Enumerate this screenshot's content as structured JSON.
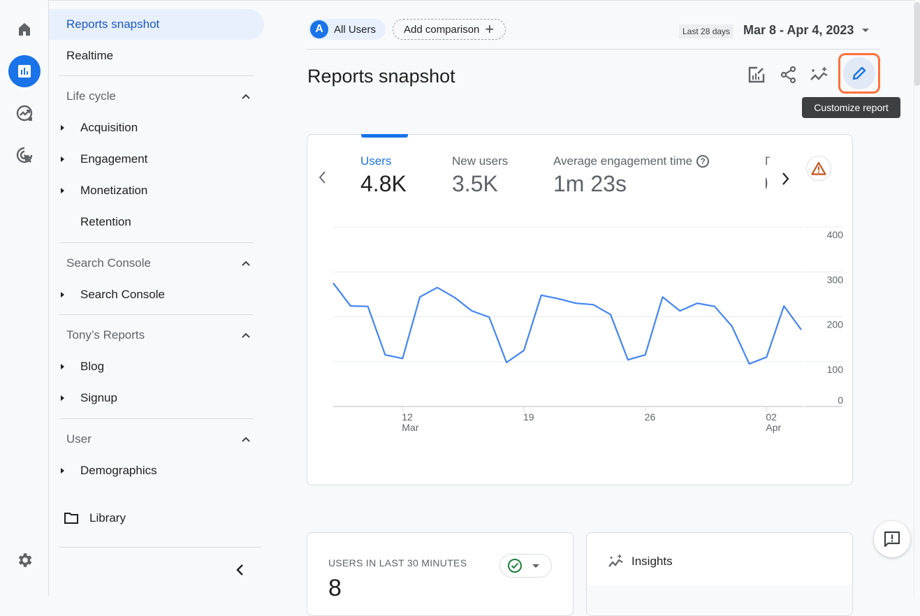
{
  "rail": {
    "items": [
      {
        "icon": "home-icon"
      },
      {
        "icon": "reports-icon",
        "active": true
      },
      {
        "icon": "explore-icon"
      },
      {
        "icon": "advertising-icon"
      }
    ],
    "settings_icon": "gear-icon"
  },
  "nav": {
    "top_items": [
      {
        "label": "Reports snapshot",
        "active": true
      },
      {
        "label": "Realtime"
      }
    ],
    "sections": [
      {
        "title": "Life cycle",
        "items": [
          "Acquisition",
          "Engagement",
          "Monetization",
          "Retention"
        ]
      },
      {
        "title": "Search Console",
        "items": [
          "Search Console"
        ]
      },
      {
        "title": "Tony’s Reports",
        "items": [
          "Blog",
          "Signup"
        ]
      },
      {
        "title": "User",
        "items": [
          "Demographics"
        ]
      }
    ],
    "library_label": "Library"
  },
  "header": {
    "segment_avatar": "A",
    "segment_label": "All Users",
    "add_comparison_label": "Add comparison",
    "date_badge": "Last 28 days",
    "date_range": "Mar 8 - Apr 4, 2023",
    "page_title": "Reports snapshot",
    "tooltip": "Customize report"
  },
  "metrics": [
    {
      "label": "Users",
      "value": "4.8K",
      "active": true
    },
    {
      "label": "New users",
      "value": "3.5K"
    },
    {
      "label": "Average engagement time",
      "value": "1m 23s",
      "help": "?"
    }
  ],
  "chart_data": {
    "type": "line",
    "title": "",
    "series": [
      {
        "name": "Users",
        "color": "#4285f4",
        "values": [
          275,
          224,
          223,
          115,
          107,
          244,
          265,
          243,
          213,
          199,
          98,
          125,
          248,
          240,
          230,
          227,
          205,
          104,
          115,
          244,
          213,
          230,
          223,
          179,
          95,
          110,
          224,
          171
        ]
      }
    ],
    "x": [
      "Mar 8",
      "Mar 9",
      "Mar 10",
      "Mar 11",
      "Mar 12",
      "Mar 13",
      "Mar 14",
      "Mar 15",
      "Mar 16",
      "Mar 17",
      "Mar 18",
      "Mar 19",
      "Mar 20",
      "Mar 21",
      "Mar 22",
      "Mar 23",
      "Mar 24",
      "Mar 25",
      "Mar 26",
      "Mar 27",
      "Mar 28",
      "Mar 29",
      "Mar 30",
      "Mar 31",
      "Apr 1",
      "Apr 2",
      "Apr 3",
      "Apr 4"
    ],
    "x_ticks": [
      {
        "index": 4,
        "day": "12",
        "month": "Mar"
      },
      {
        "index": 11,
        "day": "19",
        "month": ""
      },
      {
        "index": 18,
        "day": "26",
        "month": ""
      },
      {
        "index": 25,
        "day": "02",
        "month": "Apr"
      }
    ],
    "y_ticks": [
      0,
      100,
      200,
      300,
      400
    ],
    "ylim": [
      0,
      400
    ],
    "xlabel": "",
    "ylabel": "",
    "grid": true,
    "legend": "none"
  },
  "realtime": {
    "label": "USERS IN LAST 30 MINUTES",
    "value": "8"
  },
  "insights": {
    "title": "Insights"
  }
}
